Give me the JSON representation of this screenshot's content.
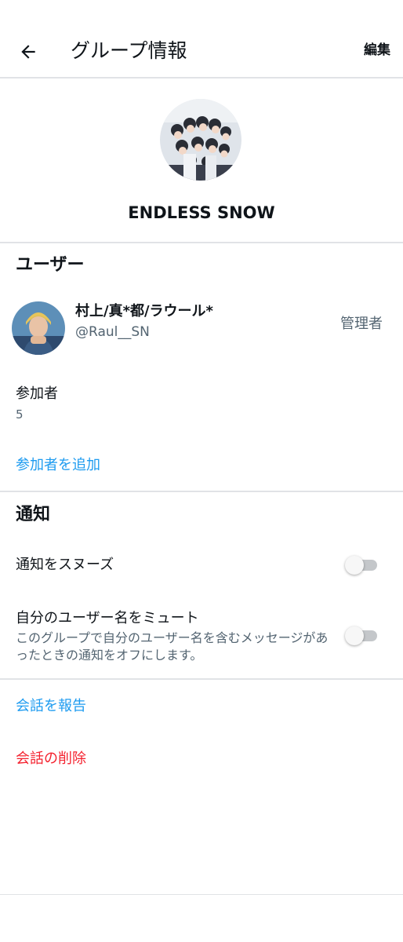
{
  "header": {
    "title": "グループ情報",
    "edit_label": "編集"
  },
  "group": {
    "name": "ENDLESS SNOW"
  },
  "users_section": {
    "title": "ユーザー",
    "admin_user": {
      "display_name": "村上/真*都/ラウール*",
      "handle": "@Raul__SN",
      "role": "管理者"
    },
    "participants_label": "参加者",
    "participants_count": "5",
    "add_participants_label": "参加者を追加"
  },
  "notifications_section": {
    "title": "通知",
    "snooze_label": "通知をスヌーズ",
    "snooze_enabled": false,
    "mute_username_label": "自分のユーザー名をミュート",
    "mute_username_desc": "このグループで自分のユーザー名を含むメッセージがあったときの通知をオフにします。",
    "mute_username_enabled": false
  },
  "actions": {
    "report_label": "会話を報告",
    "delete_label": "会話の削除"
  },
  "colors": {
    "link_blue": "#1d9bf0",
    "danger_red": "#f4212e",
    "secondary_text": "#536471",
    "divider": "#e1e3e6"
  }
}
